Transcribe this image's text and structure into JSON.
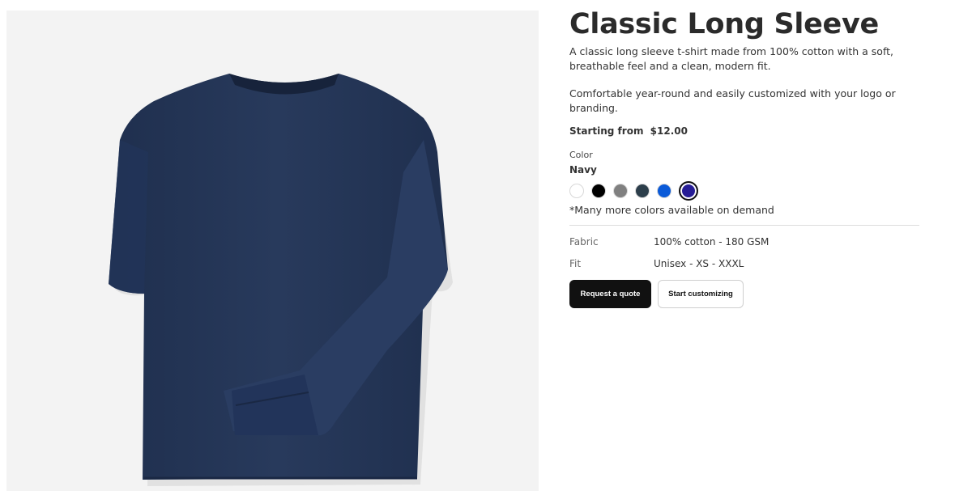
{
  "product": {
    "title": "Classic Long Sleeve",
    "description_1": "A classic long sleeve t-shirt made from 100% cotton with a soft, breathable feel and a clean, modern fit.",
    "description_2": "Comfortable year-round and easily customized with your logo or branding.",
    "price_label": "Starting from",
    "price_value": "$12.00",
    "color_label": "Color",
    "selected_color": "Navy",
    "swatches": [
      {
        "name": "white",
        "hex": "#ffffff"
      },
      {
        "name": "black",
        "hex": "#000000"
      },
      {
        "name": "gray",
        "hex": "#808080"
      },
      {
        "name": "charcoal",
        "hex": "#2c3e4b"
      },
      {
        "name": "royal-blue",
        "hex": "#0a5ad8"
      },
      {
        "name": "navy",
        "hex": "#261c96",
        "selected": true
      }
    ],
    "more_colors_note": "*Many more colors available on demand",
    "specs": [
      {
        "label": "Fabric",
        "value": "100% cotton - 180 GSM"
      },
      {
        "label": "Fit",
        "value": "Unisex - XS - XXXL"
      }
    ],
    "buttons": {
      "primary": "Request a quote",
      "secondary": "Start customizing"
    },
    "image_color": "#263859"
  }
}
